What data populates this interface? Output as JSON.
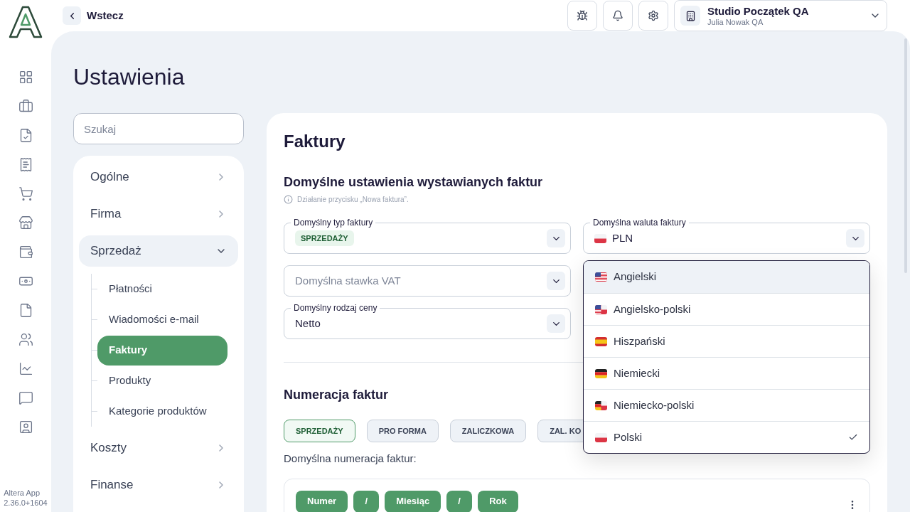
{
  "back": "Wstecz",
  "version": [
    "Altera App",
    "2.36.0+1604"
  ],
  "account": {
    "name": "Studio Początek QA",
    "user": "Julia Nowak QA"
  },
  "title": "Ustawienia",
  "search": {
    "placeholder": "Szukaj"
  },
  "nav": [
    {
      "label": "Ogólne",
      "expanded": false
    },
    {
      "label": "Firma",
      "expanded": false
    },
    {
      "label": "Sprzedaż",
      "expanded": true,
      "children": [
        {
          "label": "Płatności",
          "selected": false
        },
        {
          "label": "Wiadomości e-mail",
          "selected": false
        },
        {
          "label": "Faktury",
          "selected": true
        },
        {
          "label": "Produkty",
          "selected": false
        },
        {
          "label": "Kategorie produktów",
          "selected": false
        }
      ]
    },
    {
      "label": "Koszty",
      "expanded": false
    },
    {
      "label": "Finanse",
      "expanded": false
    }
  ],
  "content": {
    "title": "Faktury",
    "defaults": {
      "heading": "Domyślne ustawienia wystawianych faktur",
      "info": "Działanie przycisku „Nowa faktura”.",
      "fields": [
        {
          "kind": "badge",
          "label": "Domyślny typ faktury",
          "value": "SPRZEDAŻY"
        },
        {
          "kind": "flag",
          "label": "Domyślna waluta faktury",
          "value": "PLN",
          "flag": {
            "kind": "pl"
          }
        },
        {
          "kind": "placeholder",
          "placeholder": "Domyślna stawka VAT"
        },
        {
          "kind": "hidden"
        },
        {
          "kind": "text",
          "label": "Domyślny rodzaj ceny",
          "value": "Netto"
        }
      ]
    },
    "language_dropdown": {
      "options": [
        {
          "label": "Angielski",
          "kind": "us",
          "highlighted": true,
          "selected": false
        },
        {
          "label": "Angielsko-polski",
          "kind": "us-pl",
          "highlighted": false,
          "selected": false
        },
        {
          "label": "Hiszpański",
          "kind": "es",
          "highlighted": false,
          "selected": false
        },
        {
          "label": "Niemiecki",
          "kind": "de",
          "highlighted": false,
          "selected": false
        },
        {
          "label": "Niemiecko-polski",
          "kind": "de-pl",
          "highlighted": false,
          "selected": false
        },
        {
          "label": "Polski",
          "kind": "pl",
          "highlighted": false,
          "selected": true
        }
      ]
    },
    "numbering": {
      "heading": "Numeracja faktur",
      "tabs": [
        {
          "label": "SPRZEDAŻY",
          "selected": true
        },
        {
          "label": "PRO FORMA",
          "selected": false
        },
        {
          "label": "ZALICZKOWA",
          "selected": false
        },
        {
          "label": "ZAL. KO",
          "selected": false
        }
      ],
      "caption": "Domyślna numeracja faktur:",
      "tokens": [
        "Numer",
        "/",
        "Miesiąc",
        "/",
        "Rok"
      ]
    }
  }
}
